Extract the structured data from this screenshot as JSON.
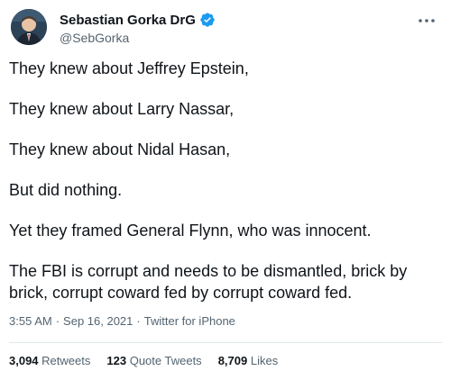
{
  "author": {
    "display_name": "Sebastian Gorka DrG",
    "handle": "@SebGorka"
  },
  "tweet": {
    "paragraphs": [
      "They knew about Jeffrey Epstein,",
      "They knew about Larry Nassar,",
      "They knew about Nidal Hasan,",
      "But did nothing.",
      "Yet they framed General Flynn, who was innocent.",
      "The FBI is corrupt and needs to be dismantled, brick by brick, corrupt coward fed by corrupt coward fed."
    ]
  },
  "meta": {
    "time": "3:55 AM",
    "separator": "·",
    "date": "Sep 16, 2021",
    "source": "Twitter for iPhone"
  },
  "stats": {
    "retweets_count": "3,094",
    "retweets_label": "Retweets",
    "quotes_count": "123",
    "quotes_label": "Quote Tweets",
    "likes_count": "8,709",
    "likes_label": "Likes"
  },
  "colors": {
    "verified": "#1d9bf0",
    "secondary_text": "#536471",
    "primary_text": "#0f1419"
  },
  "icons": [
    "verified-badge-icon",
    "more-options-icon"
  ]
}
